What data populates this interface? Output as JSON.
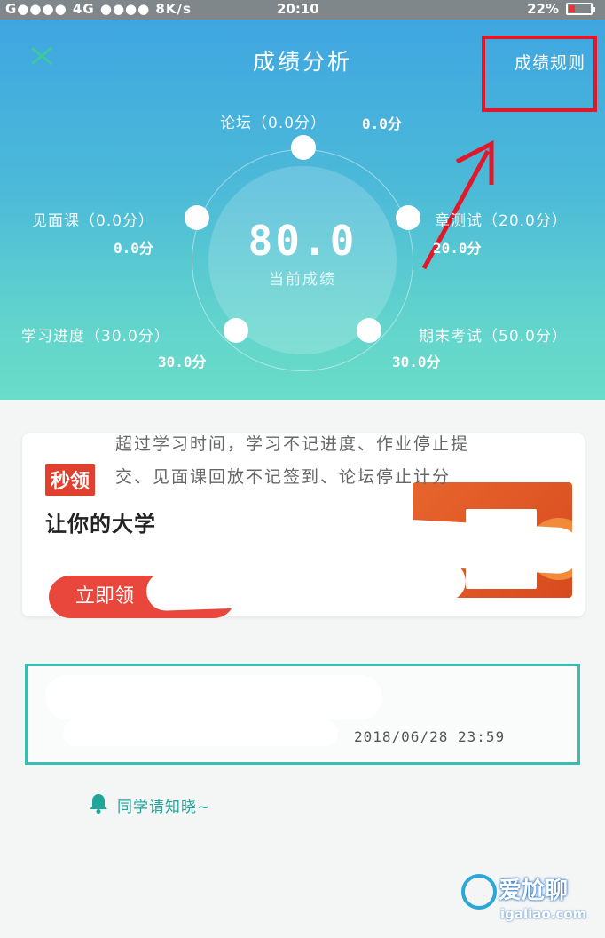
{
  "status": {
    "left": "G●●●● 4G ●●●● 8K/s",
    "time": "20:10",
    "battery": "22%"
  },
  "header": {
    "title": "成绩分析",
    "rules_link": "成绩规则"
  },
  "score": {
    "value": "80.0",
    "label": "当前成绩"
  },
  "nodes": {
    "forum": {
      "label": "论坛（0.0分）",
      "value": "0.0分"
    },
    "meeting": {
      "label": "见面课（0.0分）",
      "value": "0.0分"
    },
    "quiz": {
      "label": "章测试（20.0分）",
      "value": "20.0分"
    },
    "progress": {
      "label": "学习进度（30.0分）",
      "value": "30.0分"
    },
    "final": {
      "label": "期末考试（50.0分）",
      "value": "30.0分"
    }
  },
  "ad": {
    "badge": "秒领",
    "headline": "让你的大学",
    "cta": "立即领"
  },
  "info": {
    "date": "2018/06/28 23:59"
  },
  "notice": {
    "title": "同学请知晓~",
    "body": "超过学习时间，学习不记进度、作业停止提交、见面课回放不记签到、论坛停止计分"
  },
  "watermark": {
    "brand": "爱尬聊",
    "url": "igaliao.com"
  },
  "colors": {
    "header_top": "#3fa6e0",
    "header_bottom": "#6adcc8",
    "highlight_red": "#e0182a",
    "accent_teal": "#3bbcb2"
  }
}
